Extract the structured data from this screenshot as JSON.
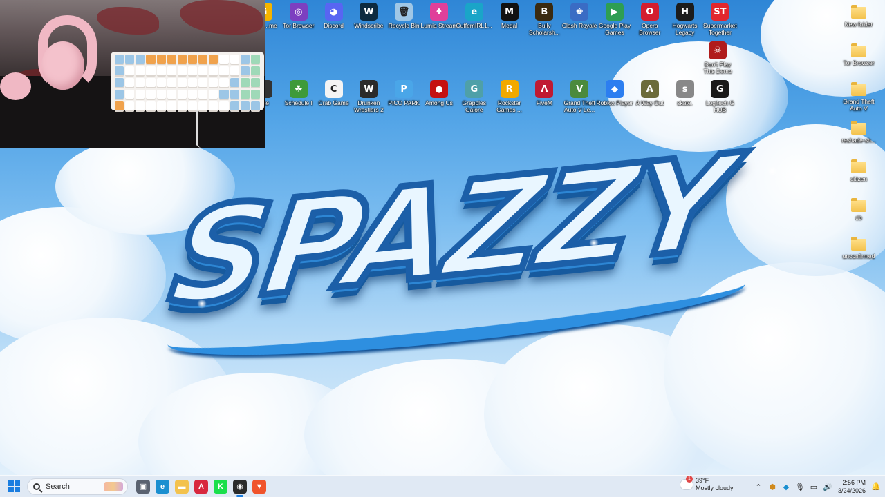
{
  "desktop": {
    "wallpaper_text": "SPAZZY",
    "icons_row1": [
      {
        "label": "...gle ...me",
        "icon": "google-chrome-icon",
        "color": "#f5b400",
        "glyph": "G"
      },
      {
        "label": "Tor Browser",
        "icon": "tor-browser-icon",
        "color": "#7d3fc0",
        "glyph": "◎"
      },
      {
        "label": "Discord",
        "icon": "discord-icon",
        "color": "#5865f2",
        "glyph": "◕"
      },
      {
        "label": "Windscribe",
        "icon": "windscribe-icon",
        "color": "#0d2a3f",
        "glyph": "W"
      },
      {
        "label": "Recycle Bin",
        "icon": "recycle-bin-icon",
        "color": "#9fc7e6",
        "glyph": "🗑"
      },
      {
        "label": "Lumia Stream",
        "icon": "lumia-stream-icon",
        "color": "#e0409a",
        "glyph": "♦"
      },
      {
        "label": "CuffemIRL1...",
        "icon": "edge-shortcut-icon",
        "color": "#1aa5c8",
        "glyph": "e"
      },
      {
        "label": "Medal",
        "icon": "medal-icon",
        "color": "#111111",
        "glyph": "M"
      },
      {
        "label": "Bully Scholarsh...",
        "icon": "bully-icon",
        "color": "#3a2a10",
        "glyph": "B"
      },
      {
        "label": "Clash Royale",
        "icon": "clash-royale-icon",
        "color": "#3a6cc4",
        "glyph": "♚"
      },
      {
        "label": "Google Play Games",
        "icon": "google-play-games-icon",
        "color": "#2e9e52",
        "glyph": "▶"
      },
      {
        "label": "Opera Browser",
        "icon": "opera-icon",
        "color": "#d41e2f",
        "glyph": "O"
      },
      {
        "label": "Hogwarts Legacy",
        "icon": "hogwarts-legacy-icon",
        "color": "#1c1c1c",
        "glyph": "H"
      },
      {
        "label": "Supermarket Together",
        "icon": "supermarket-together-icon",
        "color": "#e2272e",
        "glyph": "ST"
      }
    ],
    "icons_row2": [
      {
        "label": "...ite",
        "icon": "app-icon",
        "color": "#333333",
        "glyph": "·"
      },
      {
        "label": "Schedule I",
        "icon": "schedule-i-icon",
        "color": "#3e9a3a",
        "glyph": "☘"
      },
      {
        "label": "Crab Game",
        "icon": "crab-game-icon",
        "color": "#f4f4f4",
        "glyph": "C"
      },
      {
        "label": "Drunken Wrestlers 2",
        "icon": "drunken-wrestlers-icon",
        "color": "#2b2b2b",
        "glyph": "W"
      },
      {
        "label": "PICO PARK",
        "icon": "pico-park-icon",
        "color": "#4aa6e8",
        "glyph": "P"
      },
      {
        "label": "Among Us",
        "icon": "among-us-icon",
        "color": "#c51111",
        "glyph": "●"
      },
      {
        "label": "Grapples Galore",
        "icon": "grapples-galore-icon",
        "color": "#4fa0a8",
        "glyph": "G"
      },
      {
        "label": "Rockstar Games ...",
        "icon": "rockstar-icon",
        "color": "#f2a900",
        "glyph": "R"
      },
      {
        "label": "FiveM",
        "icon": "fivem-icon",
        "color": "#c01a32",
        "glyph": "Λ"
      },
      {
        "label": "Grand Theft Auto V Le...",
        "icon": "gta-v-icon",
        "color": "#4b8a3d",
        "glyph": "V"
      },
      {
        "label": "Roblox Player",
        "icon": "roblox-icon",
        "color": "#2c7ef0",
        "glyph": "◆"
      },
      {
        "label": "A Way Out",
        "icon": "a-way-out-icon",
        "color": "#6b6b3a",
        "glyph": "A"
      },
      {
        "label": "skate.",
        "icon": "skate-icon",
        "color": "#888888",
        "glyph": "s"
      },
      {
        "label": "Logitech G HUB",
        "icon": "logitech-g-hub-icon",
        "color": "#1a1a1a",
        "glyph": "G"
      }
    ],
    "icon_dontplay": {
      "label": "Don't Play This Demo",
      "icon": "dont-play-this-demo-icon",
      "color": "#b01c1c",
      "glyph": "☠"
    },
    "folders": [
      {
        "label": "New folder"
      },
      {
        "label": "Tor Browser"
      },
      {
        "label": "Grand Theft Auto V"
      },
      {
        "label": "reshade-sh..."
      },
      {
        "label": "citizen"
      },
      {
        "label": "db"
      },
      {
        "label": "unconfirmed"
      }
    ]
  },
  "taskbar": {
    "search_placeholder": "Search",
    "apps": [
      {
        "name": "task-view-icon",
        "color": "#5a6270",
        "glyph": "▣"
      },
      {
        "name": "edge-icon",
        "color": "#1a8fd0",
        "glyph": "e"
      },
      {
        "name": "file-explorer-icon",
        "color": "#f3c24d",
        "glyph": "▬"
      },
      {
        "name": "adobe-acrobat-icon",
        "color": "#d8283e",
        "glyph": "A"
      },
      {
        "name": "kick-icon",
        "color": "#1adf4b",
        "glyph": "K"
      },
      {
        "name": "obs-icon",
        "color": "#2b2b2b",
        "glyph": "◉"
      },
      {
        "name": "brave-icon",
        "color": "#f0532b",
        "glyph": "▼"
      }
    ],
    "weather": {
      "temp": "39°F",
      "condition": "Mostly cloudy",
      "badge": "1"
    },
    "time": "2:56 PM",
    "date": "3/24/2026"
  }
}
